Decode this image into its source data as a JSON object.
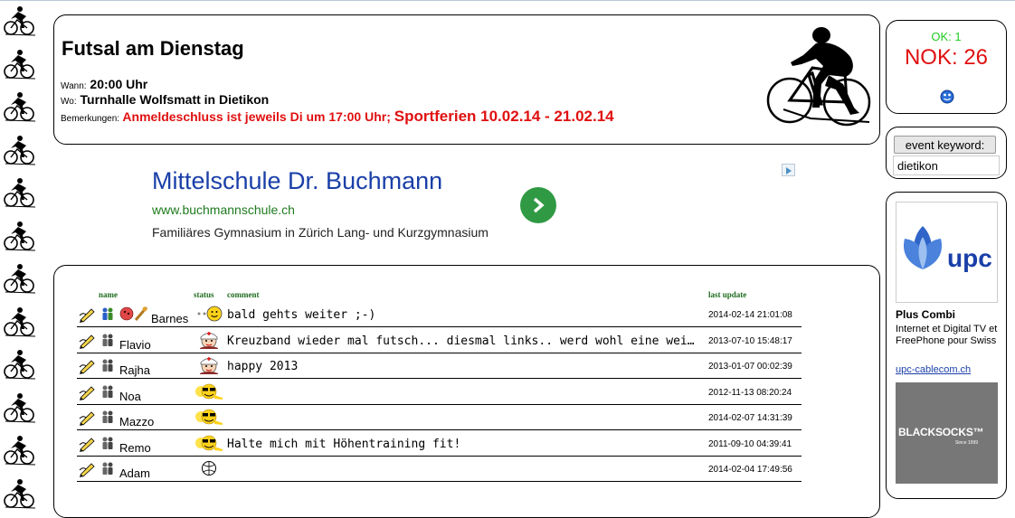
{
  "event": {
    "title": "Futsal am Dienstag",
    "when_label": "Wann:",
    "when_value": "20:00 Uhr",
    "where_label": "Wo:",
    "where_value": "Turnhalle Wolfsmatt in Dietikon",
    "notes_label": "Bemerkungen:",
    "notes_part1": "Anmeldeschluss ist jeweils Di um 17:00 Uhr;",
    "notes_part2": "Sportferien 10.02.14 - 21.02.14",
    "icon": "cyclist-icon"
  },
  "status": {
    "ok_text": "OK: 1",
    "nok_text": "NOK: 26",
    "ok_color": "#22cc22",
    "nok_color": "#e01010"
  },
  "keyword": {
    "button_label": "event keyword:",
    "input_value": "dietikon"
  },
  "ad_banner": {
    "title": "Mittelschule Dr. Buchmann",
    "url": "www.buchmannschule.ch",
    "description": "Familiäres Gymnasium in Zürich Lang- und Kurzgymnasium"
  },
  "side_ads": {
    "upc_logo_text": "upc",
    "ad1_title": "Plus Combi",
    "ad1_text": "Internet et Digital TV et FreePhone pour Swiss",
    "ad1_link": "upc-cablecom.ch",
    "ad2_logo_text": "BLACKSOCKS™",
    "ad2_since": "Since 1999"
  },
  "table": {
    "headers": {
      "name": "name",
      "status": "status",
      "comment": "comment",
      "last_update": "last update"
    },
    "rows": [
      {
        "name": "Barnes",
        "status_icon": "hand-wave-smiley-icon",
        "comment": "bald gehts weiter ;-)",
        "last_update": "2014-02-14 21:01:08"
      },
      {
        "name": "Flavio",
        "status_icon": "nurse-icon",
        "comment": "Kreuzband wieder mal futsch... diesmal links.. werd wohl eine weile ausfallen..",
        "last_update": "2013-07-10 15:48:17"
      },
      {
        "name": "Rajha",
        "status_icon": "nurse-icon",
        "comment": "happy 2013",
        "last_update": "2013-01-07 00:02:39"
      },
      {
        "name": "Noa",
        "status_icon": "sunglasses-smiley-icon",
        "comment": "",
        "last_update": "2012-11-13 08:20:24"
      },
      {
        "name": "Mazzo",
        "status_icon": "sunglasses-smiley-icon",
        "comment": "",
        "last_update": "2014-02-07 14:31:39"
      },
      {
        "name": "Remo",
        "status_icon": "sunglasses-smiley-icon",
        "comment": "Halte mich mit Höhentraining fit!",
        "last_update": "2011-09-10 04:39:41"
      },
      {
        "name": "Adam",
        "status_icon": "ball-icon",
        "comment": "",
        "last_update": "2014-02-04 17:49:56"
      }
    ]
  }
}
